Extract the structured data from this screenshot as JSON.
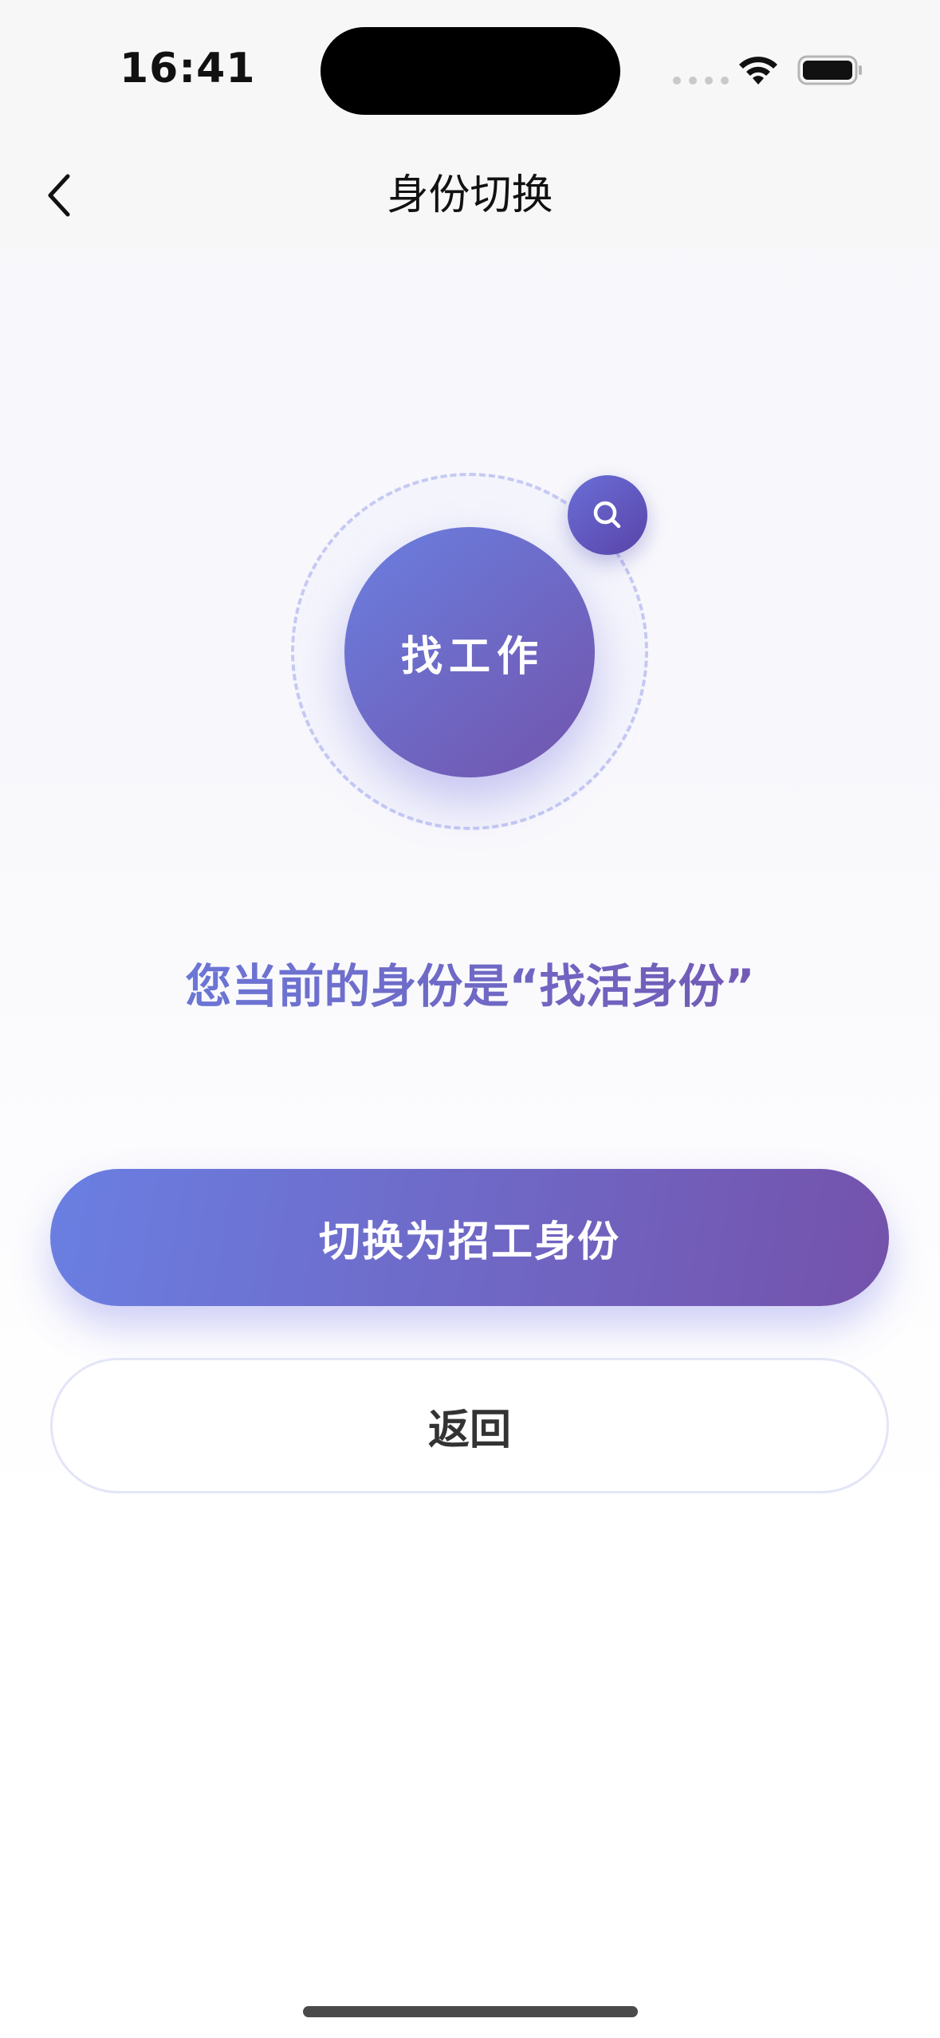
{
  "status_bar": {
    "time": "16:41",
    "icons": [
      "cellular-signal-icon",
      "wifi-icon",
      "battery-icon"
    ]
  },
  "nav": {
    "title": "身份切换",
    "back_icon": "chevron-left-icon"
  },
  "identity": {
    "circle_label": "找工作",
    "badge_icon": "search-icon",
    "current_text": "您当前的身份是“找活身份”"
  },
  "actions": {
    "switch_label": "切换为招工身份",
    "back_label": "返回"
  },
  "colors": {
    "gradient_start": "#6a7fe0",
    "gradient_end": "#7452ab",
    "ring_dash": "#c5c9f3",
    "nav_background": "#f7f7f7"
  }
}
